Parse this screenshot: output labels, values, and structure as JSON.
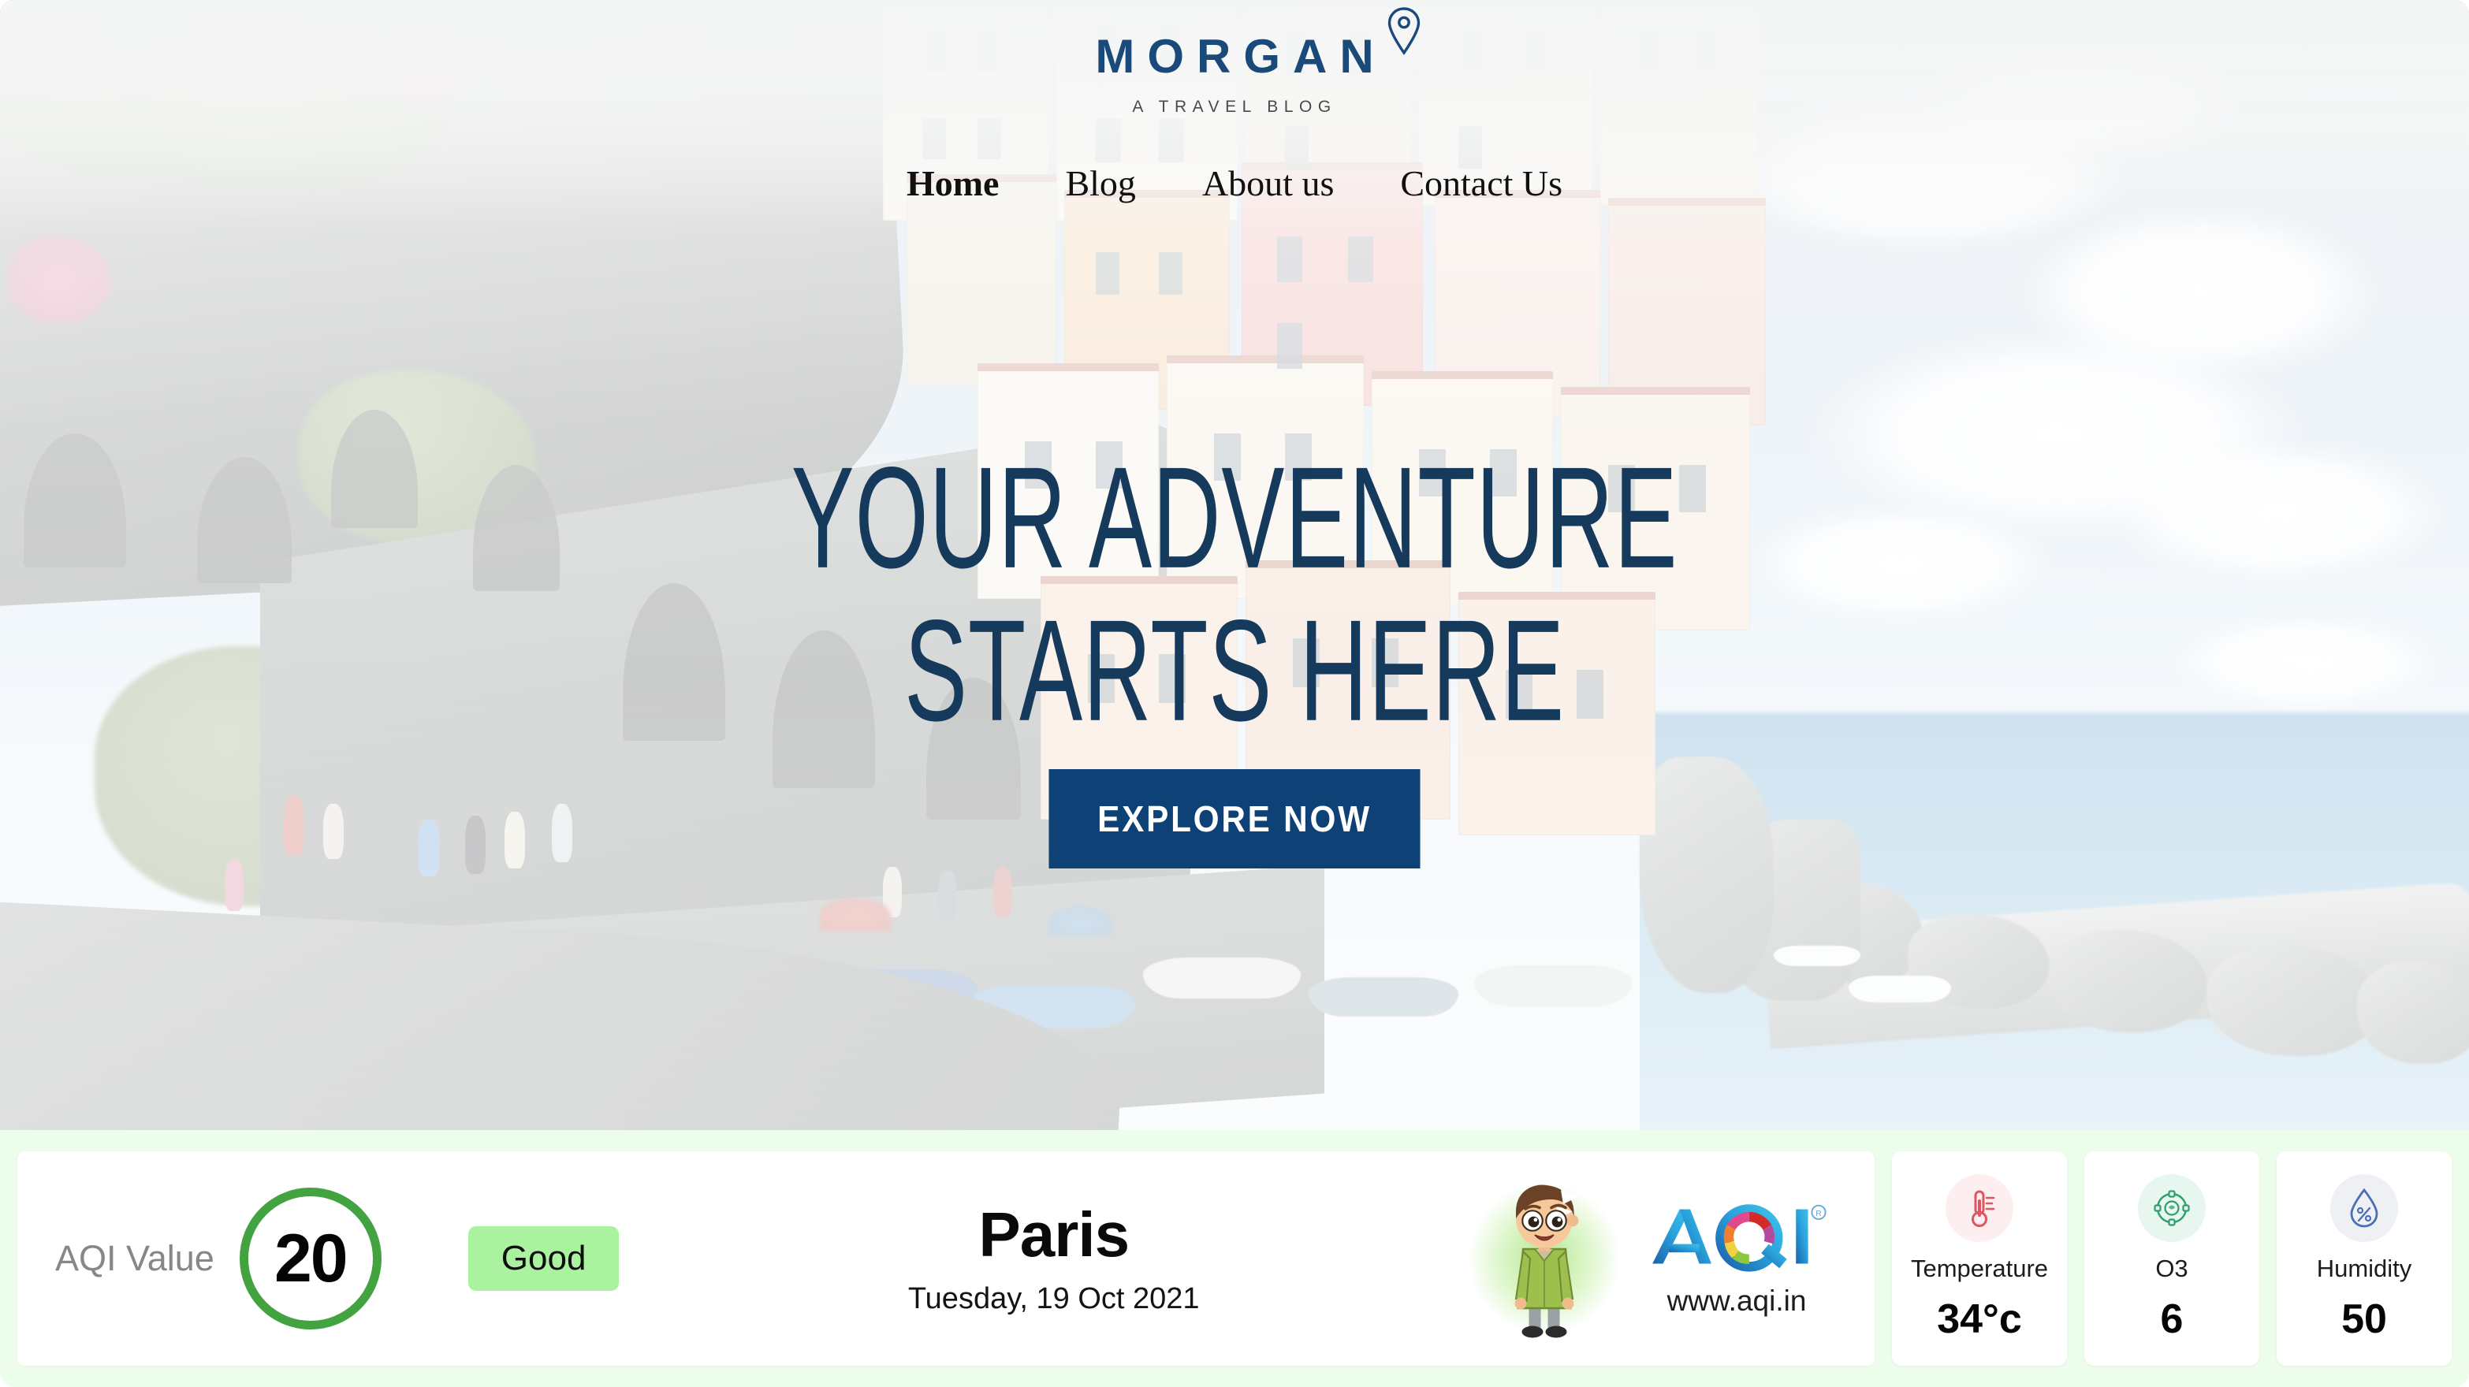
{
  "site": {
    "logo_word": "MORGAN",
    "logo_tagline": "A TRAVEL BLOG",
    "pin_icon": "location-pin-icon"
  },
  "nav": {
    "items": [
      {
        "label": "Home",
        "active": true
      },
      {
        "label": "Blog",
        "active": false
      },
      {
        "label": "About us",
        "active": false
      },
      {
        "label": "Contact Us",
        "active": false
      }
    ]
  },
  "hero": {
    "title_line1": "YOUR ADVENTURE",
    "title_line2": "STARTS HERE",
    "cta_label": "EXPLORE NOW",
    "cta_color": "#0e4175",
    "title_color": "#163a5c"
  },
  "aqi": {
    "value_label": "AQI Value",
    "value": "20",
    "ring_color": "#42a340",
    "status": "Good",
    "status_bg": "#aaf2a0",
    "city": "Paris",
    "date": "Tuesday, 19 Oct 2021",
    "mascot_icon": "boy-mascot-icon",
    "brand_name": "AQI",
    "brand_mark": "®",
    "brand_url": "www.aqi.in",
    "widget_bg": "#edfdeb",
    "metrics": [
      {
        "icon": "thermometer-icon",
        "label": "Temperature",
        "value": "34°c",
        "accent": "#e0555f"
      },
      {
        "icon": "ozone-molecule-icon",
        "label": "O3",
        "value": "6",
        "accent": "#2e9e6b"
      },
      {
        "icon": "humidity-droplet-icon",
        "label": "Humidity",
        "value": "50",
        "accent": "#4a6fb5"
      }
    ]
  }
}
